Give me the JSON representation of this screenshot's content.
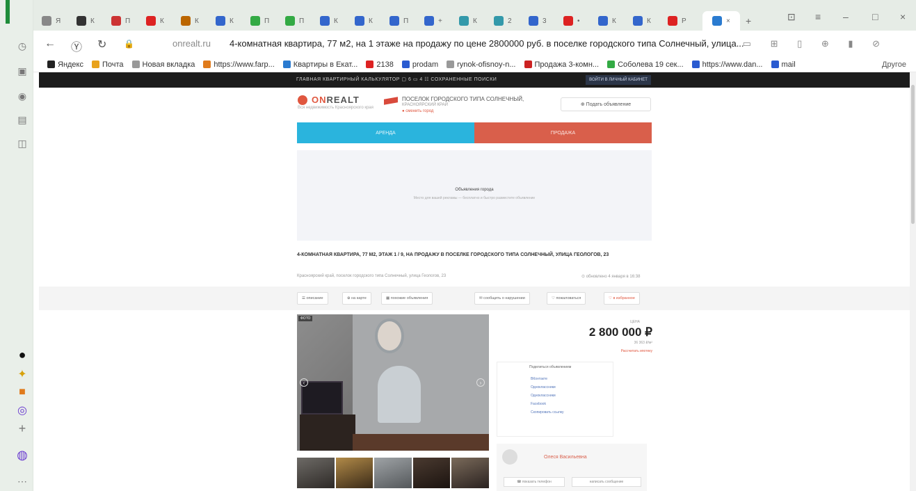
{
  "colors": {
    "sidebar_accent": "#1e8c3a",
    "rent": "#2ab4dd",
    "sale": "#d95f4b",
    "brand": "#e0573f"
  },
  "browser": {
    "sidebar_icons": [
      "profile-icon",
      "history-icon",
      "notes-icon",
      "media-icon",
      "scanner-icon",
      "screenshot-icon"
    ],
    "sidebar_bottom_icons": [
      "app-1-icon",
      "app-2-icon",
      "app-3-icon",
      "alice-icon",
      "add-icon",
      "alice-assistant-icon",
      "more-icon"
    ],
    "tabs": [
      {
        "label": "Я",
        "color": "#888"
      },
      {
        "label": "К",
        "color": "#333"
      },
      {
        "label": "П",
        "color": "#c33"
      },
      {
        "label": "К",
        "color": "#d22"
      },
      {
        "label": "К",
        "color": "#b60"
      },
      {
        "label": "К",
        "color": "#36c"
      },
      {
        "label": "П",
        "color": "#3a4"
      },
      {
        "label": "П",
        "color": "#3a4"
      },
      {
        "label": "К",
        "color": "#36c"
      },
      {
        "label": "К",
        "color": "#36c"
      },
      {
        "label": "П",
        "color": "#36c"
      },
      {
        "label": "+",
        "color": "#36c"
      },
      {
        "label": "К",
        "color": "#39a"
      },
      {
        "label": "2",
        "color": "#39a"
      },
      {
        "label": "3",
        "color": "#36c"
      },
      {
        "label": "•",
        "color": "#d22"
      },
      {
        "label": "К",
        "color": "#36c"
      },
      {
        "label": "К",
        "color": "#36c"
      },
      {
        "label": "Р",
        "color": "#d22"
      }
    ],
    "active_tab_label": "×",
    "domain": "onrealt.ru",
    "page_title": "4-комнатная квартира, 77 м2, на 1 этаже на продажу по цене 2800000 руб. в поселке городского типа Солнечный, улица...",
    "bookmarks": [
      {
        "label": "Яндекс",
        "color": "#222"
      },
      {
        "label": "Почта",
        "color": "#e8a21c"
      },
      {
        "label": "Новая вкладка",
        "color": "#999"
      },
      {
        "label": "https://www.farp...",
        "color": "#e07b1c"
      },
      {
        "label": "Квартиры в Екат...",
        "color": "#2a7bd0"
      },
      {
        "label": "2138",
        "color": "#d22"
      },
      {
        "label": "prodam",
        "color": "#2a5bd0"
      },
      {
        "label": "rynok-ofisnoy-n...",
        "color": "#999"
      },
      {
        "label": "Продажа 3-комн...",
        "color": "#c22"
      },
      {
        "label": "Соболева 19 сек...",
        "color": "#3a4"
      },
      {
        "label": "https://www.dan...",
        "color": "#2a5bd0"
      },
      {
        "label": "mail",
        "color": "#2a5bd0"
      }
    ],
    "bookmarks_other": "Другое"
  },
  "site": {
    "top_links": "ГЛАВНАЯ   КВАРТИРНЫЙ КАЛЬКУЛЯТОР   ▢ 6   ▭ 4   ☷ СОХРАНЕННЫЕ ПОИСКИ",
    "top_button": "ВОЙТИ В ЛИЧНЫЙ КАБИНЕТ",
    "logo_on": "ON",
    "logo_realt": "REALT",
    "logo_sub": "Вся недвижимость Красноярского края",
    "location_title": "ПОСЕЛОК ГОРОДСКОГО ТИПА СОЛНЕЧНЫЙ,",
    "location_region": "КРАСНОЯРСКИЙ КРАЙ",
    "location_change": "● сменить город",
    "submit_ad": "⊕ Подать объявление",
    "rent_tab": "АРЕНДА",
    "sale_tab": "ПРОДАЖА",
    "ad_title": "Объявления города",
    "ad_text": "Место для вашей рекламы — бесплатно и быстро разместите объявление",
    "listing_heading": "4-КОМНАТНАЯ КВАРТИРА, 77 М2, ЭТАЖ 1 / 9, НА ПРОДАЖУ В ПОСЕЛКЕ ГОРОДСКОГО ТИПА СОЛНЕЧНЫЙ, УЛИЦА ГЕОЛОГОВ, 23",
    "address_line": "Красноярский край, поселок городского типа Солнечный, улица Геологов, 23",
    "updated": "⊙ обновлено 4 января в 16:38",
    "pills": [
      "☰ описание",
      "⊕ на карте",
      "▦ похожие объявления",
      "✉ сообщить о нарушении",
      "♡ пожаловаться",
      "♡ в избранное"
    ],
    "photo_badge": "ФОТО",
    "price_label": "ЦЕНА",
    "price": "2 800 000 ₽",
    "price_per_m": "36 363 ₽/м²",
    "mortgage": "Рассчитать ипотеку",
    "share_title": "Поделиться объявлением",
    "share_items": [
      "ВКонтакте",
      "Одноклассники",
      "Одноклассники",
      "Facebook",
      "Скопировать ссылку"
    ],
    "agent_name": "Олеся Васильевна",
    "show_phone": "☎ показать телефон",
    "write_message": "написать сообщение"
  }
}
